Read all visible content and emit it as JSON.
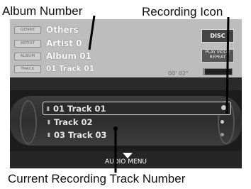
{
  "callouts": {
    "album_number": "Album Number",
    "recording_icon": "Recording Icon",
    "current_recording_track_number": "Current Recording Track Number"
  },
  "info": {
    "genre_tag": "GENRE",
    "genre": "Others",
    "artist_tag": "ARTIST",
    "artist": "Artist 0",
    "album_tag": "ALBUM",
    "album": "Album 01",
    "track_tag": "TRACK",
    "track": "01 Track 01",
    "elapsed": "00' 02\""
  },
  "buttons": {
    "top": "DISC",
    "mode_line1": "PLAY MODE",
    "mode_line2": "REPEAT"
  },
  "progress_fraction": 0.05,
  "tracks": [
    {
      "label": "01 Track 01",
      "selected": true,
      "recorded": true
    },
    {
      "label": "Track 02",
      "selected": false,
      "recorded": true
    },
    {
      "label": "03 Track 03",
      "selected": false,
      "recorded": true
    }
  ],
  "audio_menu": "AUDIO MENU",
  "colors": {
    "screen": "#3a3a3a",
    "info_panel": "#bdbdbd",
    "callout_line": "#000000"
  }
}
